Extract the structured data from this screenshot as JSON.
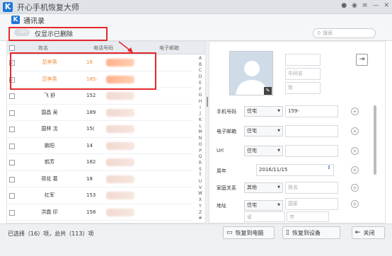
{
  "app": {
    "title": "开心手机恢复大师",
    "logo": "K"
  },
  "sub": {
    "title": "通讯录"
  },
  "toolbar": {
    "toggle_text": "OFF",
    "toggle_label": "仅显示已删除",
    "search_placeholder": "搜索"
  },
  "table": {
    "headers": {
      "name": "姓名",
      "phone": "电话号码",
      "email": "电子邮箱"
    },
    "rows": [
      {
        "name": "范李燕",
        "phone": "18",
        "selected": true,
        "checked": true
      },
      {
        "name": "范李燕",
        "phone": "185-",
        "selected": true,
        "checked": true
      },
      {
        "name": "飞 舒",
        "phone": "152",
        "selected": false,
        "checked": false
      },
      {
        "name": "国昌 吴",
        "phone": "189",
        "selected": false,
        "checked": false
      },
      {
        "name": "国林 沈",
        "phone": "15(",
        "selected": false,
        "checked": false
      },
      {
        "name": "鹏阳",
        "phone": "14",
        "selected": false,
        "checked": false
      },
      {
        "name": "鹤芳",
        "phone": "182",
        "selected": false,
        "checked": false
      },
      {
        "name": "荷花 葛",
        "phone": "18",
        "selected": false,
        "checked": false
      },
      {
        "name": "红军",
        "phone": "153",
        "selected": false,
        "checked": false
      },
      {
        "name": "洪霞 印",
        "phone": "158",
        "selected": false,
        "checked": false
      }
    ],
    "alphabet": [
      "A",
      "B",
      "C",
      "D",
      "E",
      "F",
      "G",
      "H",
      "I",
      "J",
      "K",
      "L",
      "M",
      "N",
      "O",
      "P",
      "Q",
      "R",
      "S",
      "T",
      "U",
      "V",
      "W",
      "X",
      "Y",
      "Z",
      "#"
    ]
  },
  "detail": {
    "middle_placeholder": "中间名",
    "last_placeholder": "姓",
    "phone_label": "手机号码",
    "phone_type": "住宅",
    "phone_value": "159-",
    "email_label": "电子邮箱",
    "email_type": "住宅",
    "url_label": "Url",
    "url_type": "住宅",
    "anniv_label": "周年",
    "anniv_value": "2016/11/15",
    "family_label": "家庭关系",
    "family_type": "其他",
    "family_placeholder": "姓名",
    "addr_label": "地址",
    "addr_type": "住宅",
    "addr_country": "国家",
    "addr_province": "省",
    "addr_city": "市"
  },
  "footer": {
    "status": "已选择（16）项，总共（113）项",
    "btn_computer": "恢复到电脑",
    "btn_device": "恢复到设备",
    "btn_close": "关闭"
  }
}
